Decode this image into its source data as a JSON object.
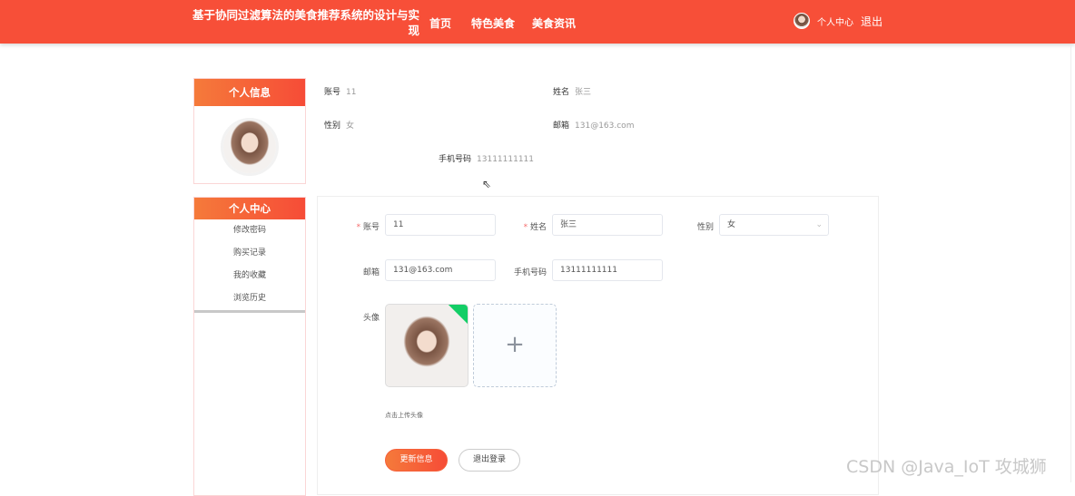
{
  "header": {
    "title": "基于协同过滤算法的美食推荐系统的设计与实现",
    "nav": [
      "首页",
      "特色美食",
      "美食资讯"
    ],
    "user_center": "个人中心",
    "logout": "退出"
  },
  "sidebar": {
    "info_title": "个人信息",
    "center_title": "个人中心",
    "menu": [
      "修改密码",
      "购买记录",
      "我的收藏",
      "浏览历史"
    ]
  },
  "info": {
    "account_label": "账号",
    "account": "11",
    "name_label": "姓名",
    "name": "张三",
    "gender_label": "性别",
    "gender": "女",
    "email_label": "邮箱",
    "email": "131@163.com",
    "phone_label": "手机号码",
    "phone": "13111111111"
  },
  "form": {
    "account_label": "账号",
    "account": "11",
    "name_label": "姓名",
    "name": "张三",
    "gender_label": "性别",
    "gender": "女",
    "email_label": "邮箱",
    "email": "131@163.com",
    "phone_label": "手机号码",
    "phone": "13111111111",
    "avatar_label": "头像",
    "upload_hint": "点击上传头像",
    "update_btn": "更新信息",
    "logout_btn": "退出登录"
  },
  "watermark": "CSDN @Java_IoT 攻城狮"
}
